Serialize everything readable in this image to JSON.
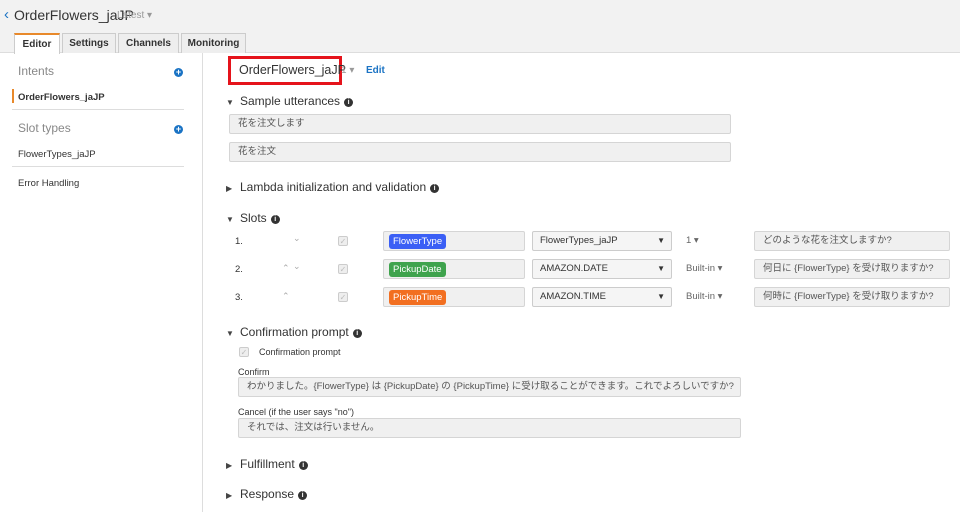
{
  "header": {
    "back_icon": "chevron-left-icon",
    "title": "OrderFlowers_jaJP",
    "version": "Latest"
  },
  "tabs": [
    "Editor",
    "Settings",
    "Channels",
    "Monitoring"
  ],
  "sidebar": {
    "intents_label": "Intents",
    "intents": [
      "OrderFlowers_jaJP"
    ],
    "slot_types_label": "Slot types",
    "slot_types": [
      "FlowerTypes_jaJP"
    ],
    "error_handling": "Error Handling"
  },
  "intent": {
    "name": "OrderFlowers_jaJP",
    "version": "1",
    "edit_label": "Edit"
  },
  "sample_utterances": {
    "label": "Sample utterances",
    "items": [
      "花を注文します",
      "花を注文"
    ]
  },
  "lambda": {
    "label": "Lambda initialization and validation"
  },
  "slots": {
    "label": "Slots",
    "rows": [
      {
        "num": "1.",
        "name": "FlowerType",
        "color": "#3b5ff5",
        "type": "FlowerTypes_jaJP",
        "version": "1",
        "prompt": "どのような花を注文しますか?"
      },
      {
        "num": "2.",
        "name": "PickupDate",
        "color": "#3fa34d",
        "type": "AMAZON.DATE",
        "version": "Built-in",
        "prompt": "何日に {FlowerType} を受け取りますか?"
      },
      {
        "num": "3.",
        "name": "PickupTime",
        "color": "#f26f21",
        "type": "AMAZON.TIME",
        "version": "Built-in",
        "prompt": "何時に {FlowerType} を受け取りますか?"
      }
    ]
  },
  "confirmation": {
    "label": "Confirmation prompt",
    "checkbox_label": "Confirmation prompt",
    "confirm_label": "Confirm",
    "confirm_value": "わかりました。{FlowerType} は {PickupDate} の {PickupTime} に受け取ることができます。これでよろしいですか?",
    "cancel_label": "Cancel (if the user says \"no\")",
    "cancel_value": "それでは、注文は行いません。"
  },
  "fulfillment": {
    "label": "Fulfillment"
  },
  "response": {
    "label": "Response"
  }
}
